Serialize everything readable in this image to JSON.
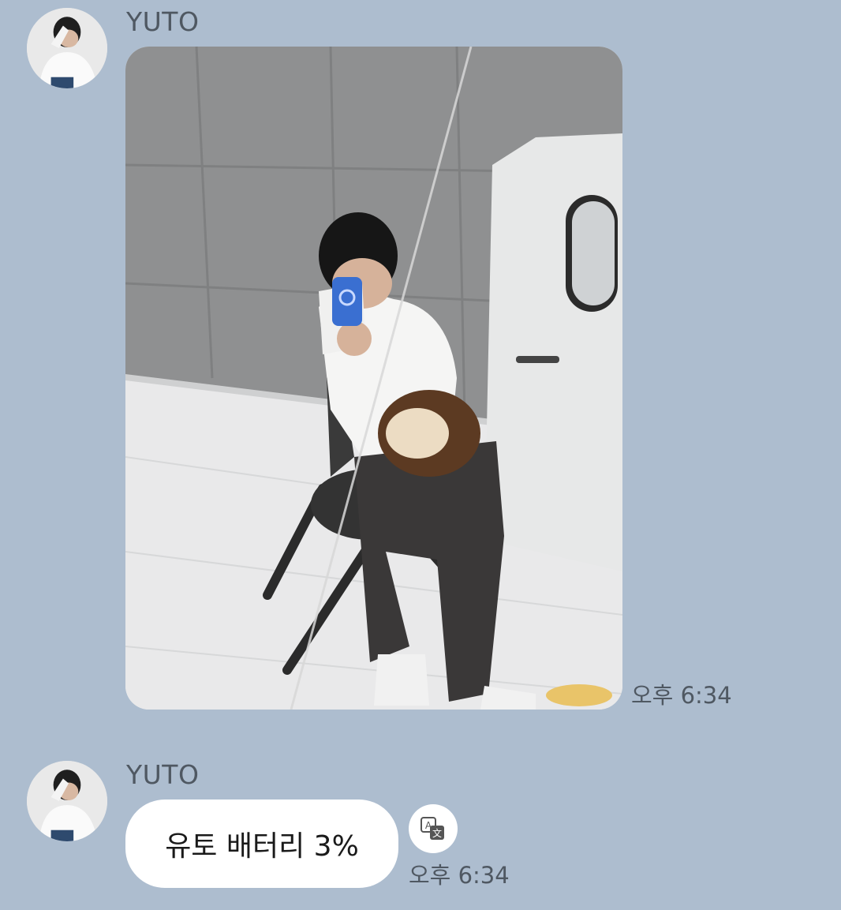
{
  "messages": [
    {
      "sender": "YUTO",
      "type": "image",
      "image_description": "mirror-selfie-photo",
      "time": "오후 6:34"
    },
    {
      "sender": "YUTO",
      "type": "text",
      "text": "유토 배터리 3%",
      "time": "오후 6:34",
      "action_icon": "translate-icon"
    }
  ],
  "colors": {
    "background": "#adbdcf",
    "bubble": "#ffffff",
    "meta_text": "#4f5862"
  }
}
